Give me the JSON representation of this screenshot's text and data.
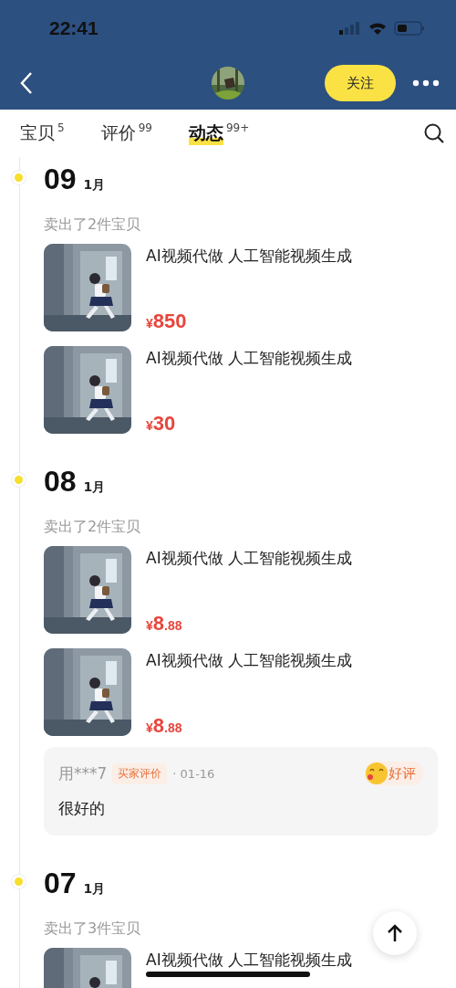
{
  "status_bar": {
    "time": "22:41"
  },
  "nav": {
    "follow_button": "关注"
  },
  "tabs": [
    {
      "label": "宝贝",
      "count": "5",
      "selected": false
    },
    {
      "label": "评价",
      "count": "99",
      "selected": false
    },
    {
      "label": "动态",
      "count": "99+",
      "selected": true
    }
  ],
  "timeline": [
    {
      "day": "09",
      "month": "1月",
      "summary": "卖出了2件宝贝",
      "items": [
        {
          "title": "AI视频代做 人工智能视频生成",
          "price": {
            "currency": "¥",
            "integer": "850"
          }
        },
        {
          "title": "AI视频代做 人工智能视频生成",
          "price": {
            "currency": "¥",
            "integer": "30"
          }
        }
      ]
    },
    {
      "day": "08",
      "month": "1月",
      "summary": "卖出了2件宝贝",
      "items": [
        {
          "title": "AI视频代做 人工智能视频生成",
          "price": {
            "currency": "¥",
            "integer": "8",
            "decimal": ".88"
          }
        },
        {
          "title": "AI视频代做 人工智能视频生成",
          "price": {
            "currency": "¥",
            "integer": "8",
            "decimal": ".88"
          }
        }
      ],
      "review": {
        "user": "用***7",
        "tag": "买家评价",
        "date": "· 01-16",
        "rating": "好评",
        "text": "很好的"
      }
    },
    {
      "day": "07",
      "month": "1月",
      "summary": "卖出了3件宝贝",
      "items": [
        {
          "title": "AI视频代做 人工智能视频生成"
        }
      ]
    }
  ]
}
